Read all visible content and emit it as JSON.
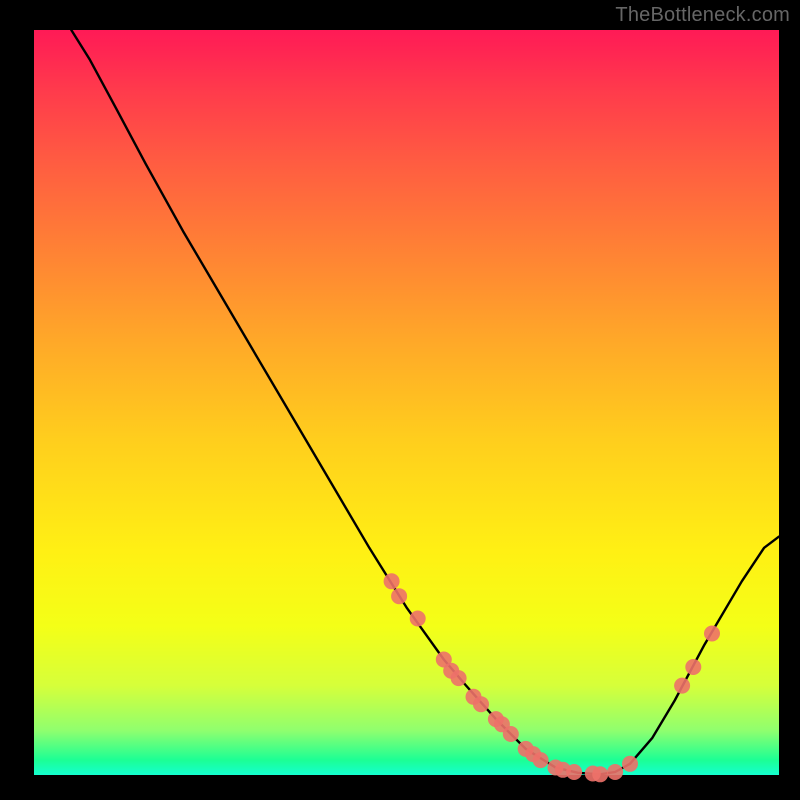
{
  "watermark": "TheBottleneck.com",
  "chart_data": {
    "type": "line",
    "title": "",
    "subtitle": "",
    "xlabel": "",
    "ylabel": "",
    "xlim": [
      0,
      100
    ],
    "ylim": [
      0,
      100
    ],
    "grid": false,
    "legend": false,
    "annotations": [],
    "series": [
      {
        "name": "curve",
        "type": "line",
        "color": "#000000",
        "points": [
          {
            "x": 5.0,
            "y": 100.0
          },
          {
            "x": 7.5,
            "y": 96.0
          },
          {
            "x": 11.0,
            "y": 89.5
          },
          {
            "x": 15.0,
            "y": 82.0
          },
          {
            "x": 20.0,
            "y": 73.0
          },
          {
            "x": 25.0,
            "y": 64.5
          },
          {
            "x": 30.0,
            "y": 56.0
          },
          {
            "x": 35.0,
            "y": 47.5
          },
          {
            "x": 40.0,
            "y": 39.0
          },
          {
            "x": 45.0,
            "y": 30.5
          },
          {
            "x": 50.0,
            "y": 22.5
          },
          {
            "x": 55.0,
            "y": 15.5
          },
          {
            "x": 58.0,
            "y": 12.0
          },
          {
            "x": 62.0,
            "y": 7.5
          },
          {
            "x": 66.0,
            "y": 3.5
          },
          {
            "x": 70.0,
            "y": 1.0
          },
          {
            "x": 73.0,
            "y": 0.3
          },
          {
            "x": 76.0,
            "y": 0.1
          },
          {
            "x": 78.0,
            "y": 0.4
          },
          {
            "x": 80.0,
            "y": 1.5
          },
          {
            "x": 83.0,
            "y": 5.0
          },
          {
            "x": 86.0,
            "y": 10.0
          },
          {
            "x": 90.0,
            "y": 17.5
          },
          {
            "x": 95.0,
            "y": 26.0
          },
          {
            "x": 98.0,
            "y": 30.5
          },
          {
            "x": 100.0,
            "y": 32.0
          }
        ]
      },
      {
        "name": "markers",
        "type": "scatter",
        "color": "#ed7169",
        "radius": 8,
        "points": [
          {
            "x": 48.0,
            "y": 26.0
          },
          {
            "x": 49.0,
            "y": 24.0
          },
          {
            "x": 51.5,
            "y": 21.0
          },
          {
            "x": 55.0,
            "y": 15.5
          },
          {
            "x": 56.0,
            "y": 14.0
          },
          {
            "x": 57.0,
            "y": 13.0
          },
          {
            "x": 59.0,
            "y": 10.5
          },
          {
            "x": 60.0,
            "y": 9.5
          },
          {
            "x": 62.0,
            "y": 7.5
          },
          {
            "x": 62.8,
            "y": 6.8
          },
          {
            "x": 64.0,
            "y": 5.5
          },
          {
            "x": 66.0,
            "y": 3.5
          },
          {
            "x": 67.0,
            "y": 2.8
          },
          {
            "x": 68.0,
            "y": 2.0
          },
          {
            "x": 70.0,
            "y": 1.0
          },
          {
            "x": 71.0,
            "y": 0.7
          },
          {
            "x": 72.5,
            "y": 0.4
          },
          {
            "x": 75.0,
            "y": 0.2
          },
          {
            "x": 76.0,
            "y": 0.1
          },
          {
            "x": 78.0,
            "y": 0.4
          },
          {
            "x": 80.0,
            "y": 1.5
          },
          {
            "x": 87.0,
            "y": 12.0
          },
          {
            "x": 88.5,
            "y": 14.5
          },
          {
            "x": 91.0,
            "y": 19.0
          }
        ]
      }
    ]
  }
}
